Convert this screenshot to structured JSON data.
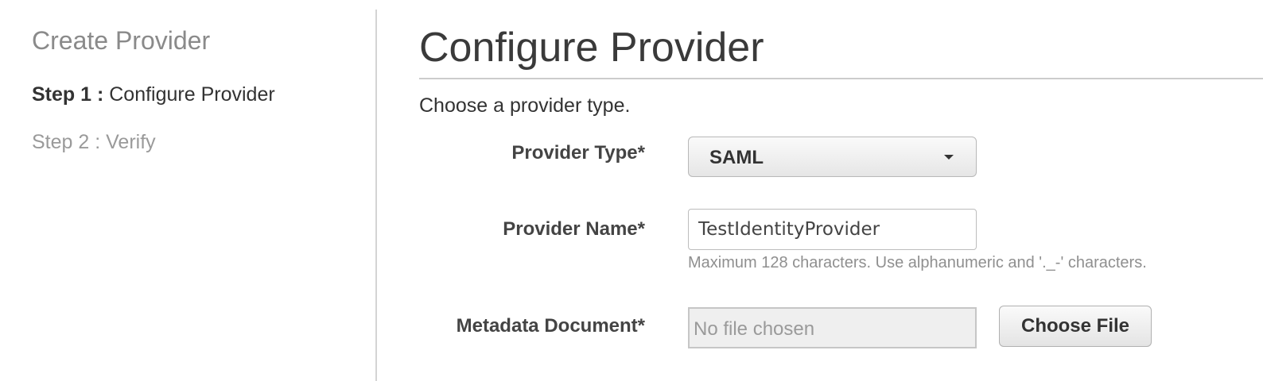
{
  "sidebar": {
    "title": "Create Provider",
    "steps": [
      {
        "prefix": "Step 1 :",
        "label": "Configure Provider",
        "active": true
      },
      {
        "prefix": "Step 2 :",
        "label": "Verify",
        "active": false
      }
    ]
  },
  "main": {
    "title": "Configure Provider",
    "intro": "Choose a provider type.",
    "form": {
      "provider_type": {
        "label": "Provider Type*",
        "value": "SAML"
      },
      "provider_name": {
        "label": "Provider Name*",
        "value": "TestIdentityProvider",
        "hint": "Maximum 128 characters. Use alphanumeric and '._-' characters."
      },
      "metadata_document": {
        "label": "Metadata Document*",
        "placeholder": "No file chosen",
        "button_label": "Choose File"
      }
    }
  },
  "icons": {
    "dropdown": "chevron-down-icon"
  }
}
